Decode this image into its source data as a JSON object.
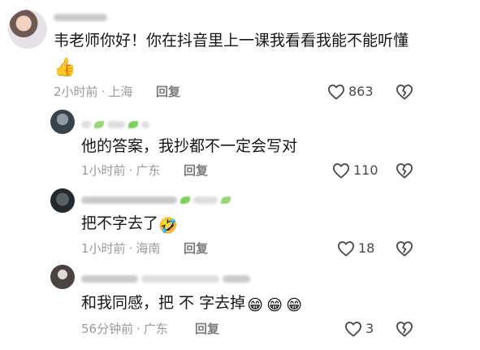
{
  "comments": [
    {
      "text": "韦老师你好！你在抖音里上一课我看看我能不能听懂",
      "emoji": "👍",
      "time": "2小时前",
      "location": "上海",
      "reply_label": "回复",
      "likes": "863"
    }
  ],
  "replies": [
    {
      "text": "他的答案，我抄都不一定会写对",
      "time": "1小时前",
      "location": "广东",
      "reply_label": "回复",
      "likes": "110"
    },
    {
      "text": "把不字去了",
      "emoji": "🤣",
      "time": "1小时前",
      "location": "海南",
      "reply_label": "回复",
      "likes": "18"
    },
    {
      "text": "和我同感，把 不 字去掉",
      "emoji": "😁",
      "time": "56分钟前",
      "location": "广东",
      "reply_label": "回复",
      "likes": "3"
    }
  ],
  "separator": "·",
  "icons": {
    "like": "heart-outline-icon",
    "dislike": "broken-heart-icon"
  },
  "colors": {
    "text": "#161616",
    "meta": "#9a9a9a",
    "reply": "#7c7c7c"
  }
}
